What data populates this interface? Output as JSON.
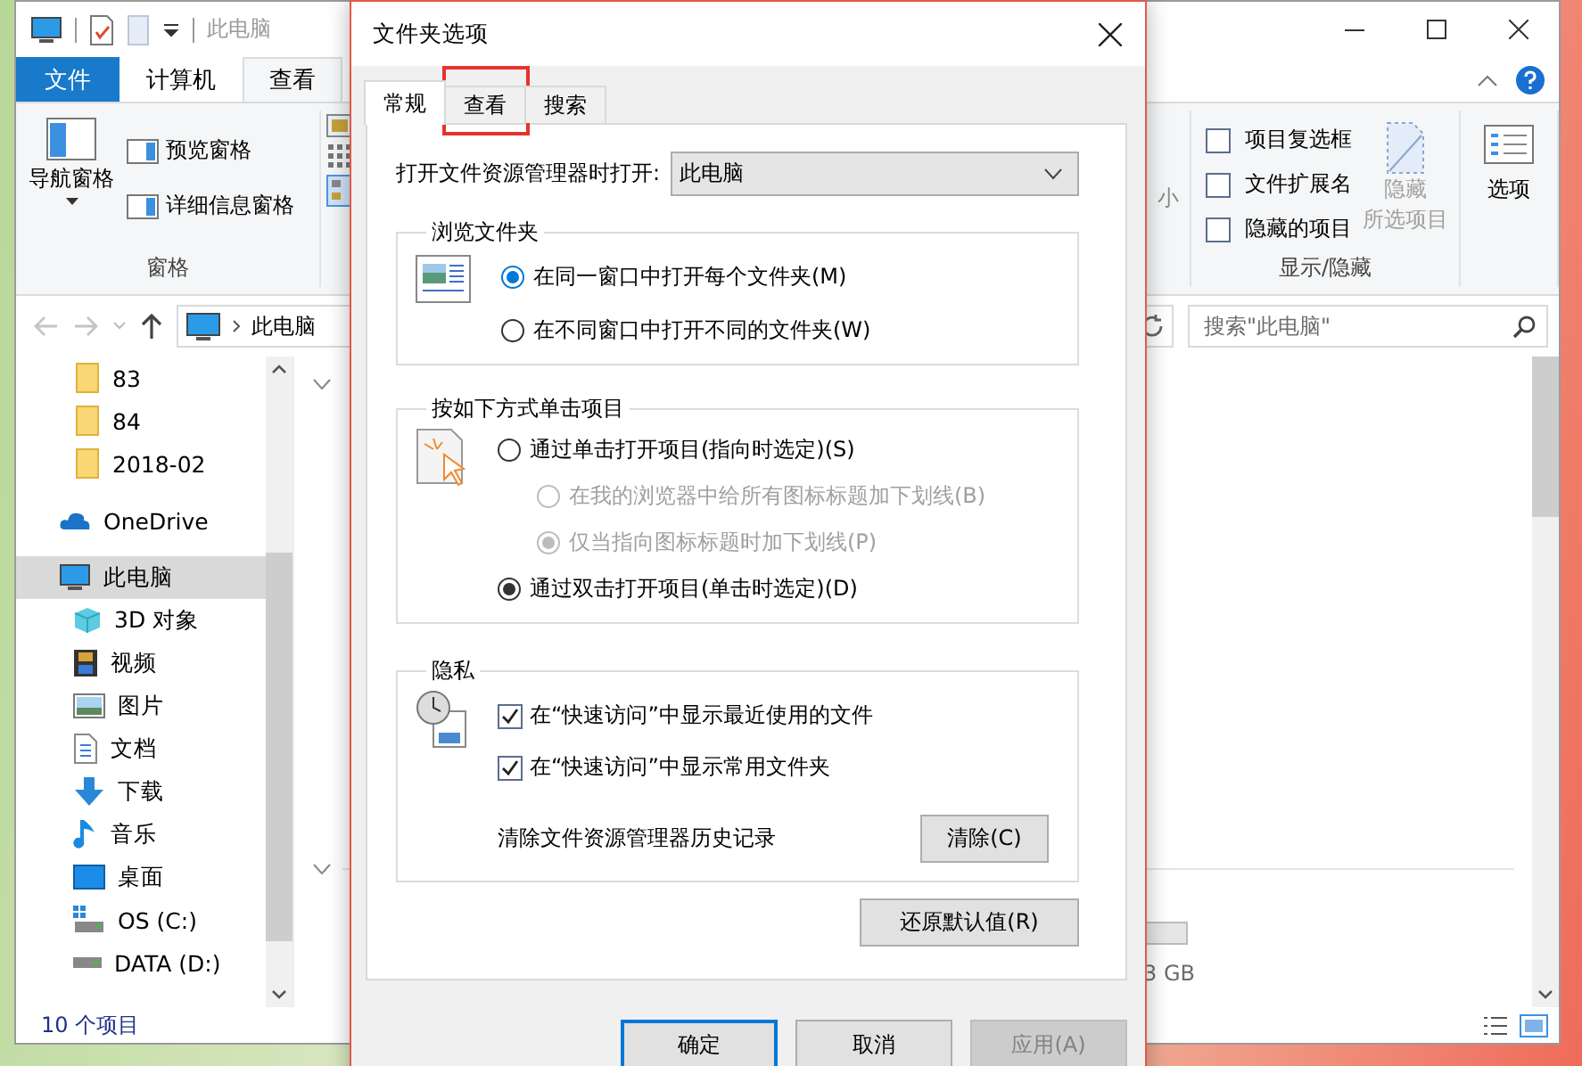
{
  "explorer": {
    "title": "此电脑",
    "ribbon_tabs": [
      {
        "label": "文件",
        "kind": "file",
        "selected": false
      },
      {
        "label": "计算机",
        "kind": "tab",
        "selected": false
      },
      {
        "label": "查看",
        "kind": "tab",
        "selected": true
      }
    ],
    "pane_group": {
      "label": "窗格",
      "nav_button": "导航窗格",
      "buttons": [
        "预览窗格",
        "详细信息窗格"
      ]
    },
    "layout_group_fragment": "小",
    "show_hide_group": {
      "label": "显示/隐藏",
      "checkboxes": [
        {
          "label": "项目复选框",
          "checked": false
        },
        {
          "label": "文件扩展名",
          "checked": false
        },
        {
          "label": "隐藏的项目",
          "checked": false
        }
      ],
      "hide_button": {
        "lines": [
          "隐藏",
          "所选项目"
        ],
        "disabled": true
      }
    },
    "options_button": "选项",
    "address": {
      "path": "此电脑"
    },
    "search": {
      "placeholder": "搜索\"此电脑\""
    },
    "nav": {
      "quick_access_items": [
        {
          "label": "83",
          "selected": false
        },
        {
          "label": "84",
          "selected": false
        },
        {
          "label": "2018-02",
          "selected": false
        }
      ],
      "items": [
        {
          "label": "OneDrive",
          "kind": "onedrive",
          "selected": false
        },
        {
          "label": "此电脑",
          "kind": "pc",
          "selected": true,
          "children": [
            {
              "label": "3D 对象",
              "kind": "objects3d",
              "selected": false
            },
            {
              "label": "视频",
              "kind": "video",
              "selected": false
            },
            {
              "label": "图片",
              "kind": "picture",
              "selected": false
            },
            {
              "label": "文档",
              "kind": "document",
              "selected": false
            },
            {
              "label": "下载",
              "kind": "download",
              "selected": false
            },
            {
              "label": "音乐",
              "kind": "music",
              "selected": false
            },
            {
              "label": "桌面",
              "kind": "desktop",
              "selected": false
            },
            {
              "label": "OS (C:)",
              "kind": "system-drive",
              "selected": false
            },
            {
              "label": "DATA (D:)",
              "kind": "drive",
              "selected": false
            }
          ]
        }
      ]
    },
    "drive_size_fragment": "3 GB",
    "status": "10 个项目"
  },
  "dialog": {
    "title": "文件夹选项",
    "tabs": [
      {
        "label": "常规",
        "selected": true,
        "highlighted": false
      },
      {
        "label": "查看",
        "selected": false,
        "highlighted": true
      },
      {
        "label": "搜索",
        "selected": false,
        "highlighted": false
      }
    ],
    "open_with": {
      "label": "打开文件资源管理器时打开:",
      "value": "此电脑"
    },
    "browse_group": {
      "title": "浏览文件夹",
      "options": [
        {
          "label": "在同一窗口中打开每个文件夹(M)",
          "selected": true,
          "focused": true
        },
        {
          "label": "在不同窗口中打开不同的文件夹(W)",
          "selected": false,
          "focused": false
        }
      ]
    },
    "click_group": {
      "title": "按如下方式单击项目",
      "options": [
        {
          "label": "通过单击打开项目(指向时选定)(S)",
          "selected": false,
          "disabled": false,
          "children": [
            {
              "label": "在我的浏览器中给所有图标标题加下划线(B)",
              "selected": false,
              "disabled": true
            },
            {
              "label": "仅当指向图标标题时加下划线(P)",
              "selected": true,
              "disabled": true
            }
          ]
        },
        {
          "label": "通过双击打开项目(单击时选定)(D)",
          "selected": true,
          "disabled": false
        }
      ]
    },
    "privacy_group": {
      "title": "隐私",
      "checkboxes": [
        {
          "label": "在“快速访问”中显示最近使用的文件",
          "checked": true
        },
        {
          "label": "在“快速访问”中显示常用文件夹",
          "checked": true
        }
      ],
      "clear_label": "清除文件资源管理器历史记录",
      "clear_button": "清除(C)"
    },
    "restore_button": "还原默认值(R)",
    "buttons": [
      {
        "label": "确定",
        "focused": true,
        "disabled": false
      },
      {
        "label": "取消",
        "focused": false,
        "disabled": false
      },
      {
        "label": "应用(A)",
        "focused": false,
        "disabled": true
      }
    ]
  }
}
